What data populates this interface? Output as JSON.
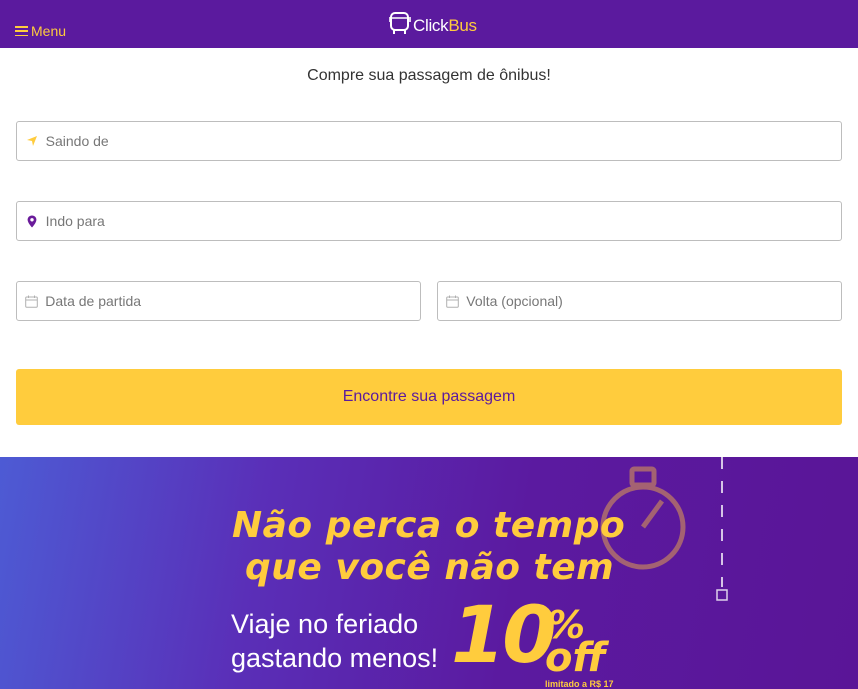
{
  "header": {
    "menu_label": "Menu",
    "logo": {
      "part1": "Click",
      "part2": "Bus"
    }
  },
  "search": {
    "subtitle": "Compre sua passagem de ônibus!",
    "origin_placeholder": "Saindo de",
    "destination_placeholder": "Indo para",
    "departure_placeholder": "Data de partida",
    "return_placeholder": "Volta (opcional)",
    "submit_label": "Encontre sua passagem"
  },
  "banner": {
    "headline_line1": "Não perca o tempo",
    "headline_line2": "que você não tem",
    "sub_line1": "Viaje no feriado",
    "sub_line2": "gastando menos!",
    "discount_number": "10",
    "discount_percent": "%",
    "discount_off": "off",
    "limit_text": "limitado a R$ 17"
  },
  "icons": {
    "menu": "hamburger-icon",
    "logo": "bus-icon",
    "origin": "location-arrow-icon",
    "destination": "map-pin-icon",
    "calendar": "calendar-icon",
    "stopwatch": "stopwatch-icon"
  },
  "colors": {
    "brand_purple": "#5b1a9e",
    "accent_yellow": "#ffcc3d",
    "pin_purple": "#6a1b9a"
  }
}
